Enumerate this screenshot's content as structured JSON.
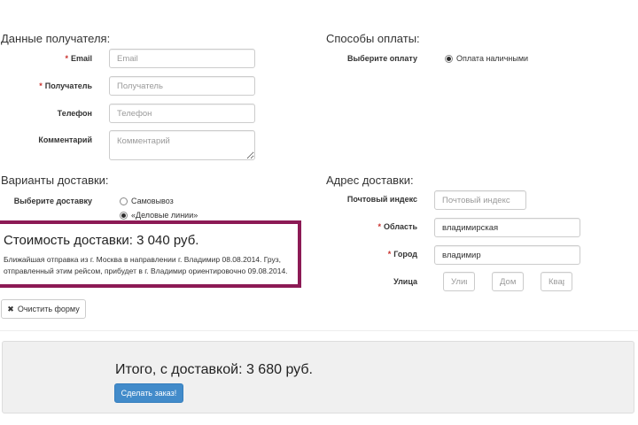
{
  "recipient": {
    "heading": "Данные получателя:",
    "email": {
      "label": "Email",
      "placeholder": "Email"
    },
    "name": {
      "label": "Получатель",
      "placeholder": "Получатель"
    },
    "phone": {
      "label": "Телефон",
      "placeholder": "Телефон"
    },
    "comment": {
      "label": "Комментарий",
      "placeholder": "Комментарий"
    }
  },
  "payment": {
    "heading": "Способы оплаты:",
    "label": "Выберите оплату",
    "options": [
      {
        "label": "Оплата наличными",
        "checked": true
      }
    ]
  },
  "delivery": {
    "heading": "Варианты доставки:",
    "label": "Выберите доставку",
    "options": [
      {
        "label": "Самовывоз",
        "checked": false
      },
      {
        "label": "«Деловые линии»",
        "checked": true
      }
    ],
    "cost_title": "Стоимость доставки: 3 040 руб.",
    "cost_note": "Ближайшая отправка из г. Москва в направлении г. Владимир 08.08.2014. Груз, отправленный этим рейсом, прибудет в г. Владимир ориентировочно 09.08.2014."
  },
  "address": {
    "heading": "Адрес доставки:",
    "zip": {
      "label": "Почтовый индекс",
      "placeholder": "Почтовый индекс"
    },
    "region": {
      "label": "Область",
      "value": "владимирская"
    },
    "city": {
      "label": "Город",
      "value": "владимир"
    },
    "street": {
      "label": "Улица",
      "street_placeholder": "Улица",
      "house_placeholder": "Дом",
      "apartment_placeholder": "Квартира"
    }
  },
  "actions": {
    "clear_label": "Очистить форму",
    "clear_icon": "✖",
    "total_text": "Итого, с доставкой: 3 680 руб.",
    "order_label": "Сделать заказ!"
  }
}
